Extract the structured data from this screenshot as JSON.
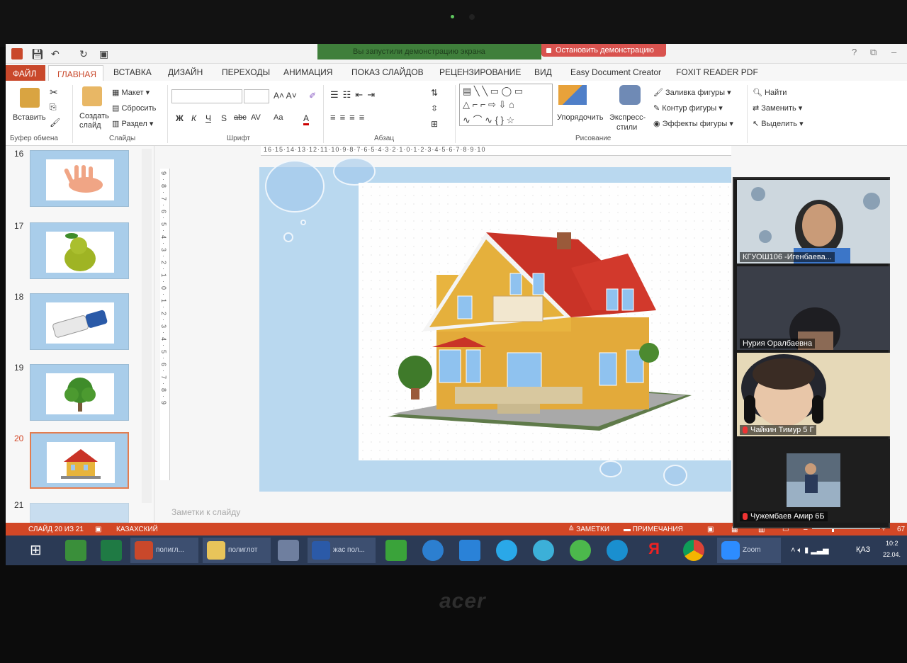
{
  "quick_access": {
    "title_icon": "powerpoint-icon",
    "save": "save-icon",
    "undo": "undo-icon",
    "redo": "redo-icon"
  },
  "share": {
    "banner": "Вы запустили демонстрацию экрана",
    "stop": "Остановить демонстрацию"
  },
  "window": {
    "help": "?",
    "restore": "⧉",
    "min": "–"
  },
  "tabs": {
    "file": "ФАЙЛ",
    "active": "ГЛАВНАЯ",
    "items": [
      "ВСТАВКА",
      "ДИЗАЙН",
      "ПЕРЕХОДЫ",
      "АНИМАЦИЯ",
      "ПОКАЗ СЛАЙДОВ",
      "РЕЦЕНЗИРОВАНИЕ",
      "ВИД",
      "Easy Document Creator",
      "FOXIT READER PDF"
    ]
  },
  "ribbon": {
    "paste": "Вставить",
    "clipboard": "Буфер обмена",
    "new_slide": "Создать слайд",
    "layout": "Макет",
    "reset": "Сбросить",
    "section": "Раздел",
    "slides": "Слайды",
    "font": "Шрифт",
    "paragraph": "Абзац",
    "arrange": "Упорядочить",
    "quick_styles_1": "Экспресс-",
    "quick_styles_2": "стили",
    "fill": "Заливка фигуры",
    "outline": "Контур фигуры",
    "effects": "Эффекты фигуры",
    "drawing": "Рисование",
    "find": "Найти",
    "replace": "Заменить",
    "select": "Выделить",
    "bold": "Ж",
    "italic": "К",
    "underline": "Ч",
    "shadow": "S",
    "strike": "abc",
    "spacing": "AV",
    "case": "Aa",
    "color": "A"
  },
  "slides": [
    {
      "num": "16",
      "subject": "hand"
    },
    {
      "num": "17",
      "subject": "pear"
    },
    {
      "num": "18",
      "subject": "eraser"
    },
    {
      "num": "19",
      "subject": "tree"
    },
    {
      "num": "20",
      "subject": "house"
    },
    {
      "num": "21",
      "subject": ""
    }
  ],
  "ruler_h": "16·15·14·13·12·11·10·9·8·7·6·5·4·3·2·1·0·1·2·3·4·5·6·7·8·9·10",
  "ruler_v": "9·8·7·6·5·4·3·2·1·0·1·2·3·4·5·6·7·8·9",
  "notes_placeholder": "Заметки к слайду",
  "status": {
    "slide": "СЛАЙД 20 ИЗ 21",
    "lang": "КАЗАХСКИЙ",
    "notes": "ЗАМЕТКИ",
    "comments": "ПРИМЕЧАНИЯ",
    "zoom": "67"
  },
  "taskbar": {
    "items": [
      {
        "label": "полигл...",
        "icon": "powerpoint-icon"
      },
      {
        "label": "полиглот",
        "icon": "folder-icon"
      },
      {
        "label": "жас пол...",
        "icon": "word-icon"
      },
      {
        "label": "Zoom",
        "icon": "zoom-icon"
      }
    ],
    "lang": "ҚАЗ",
    "time": "10:2",
    "date": "22.04."
  },
  "participants": [
    {
      "name": "КГУОШ106 -Игенбаева...",
      "muted": false
    },
    {
      "name": "Нурия Оралбаевна",
      "muted": false
    },
    {
      "name": "Чайкин Тимур 5 Г",
      "muted": true
    },
    {
      "name": "Чужембаев Амир 6Б",
      "muted": true
    }
  ],
  "laptop_brand": "acer",
  "colors": {
    "accent": "#d24726",
    "ribbon_bg": "#ffffff",
    "taskbar": "#2b3a55",
    "slide_bg": "#b9d8ef"
  }
}
